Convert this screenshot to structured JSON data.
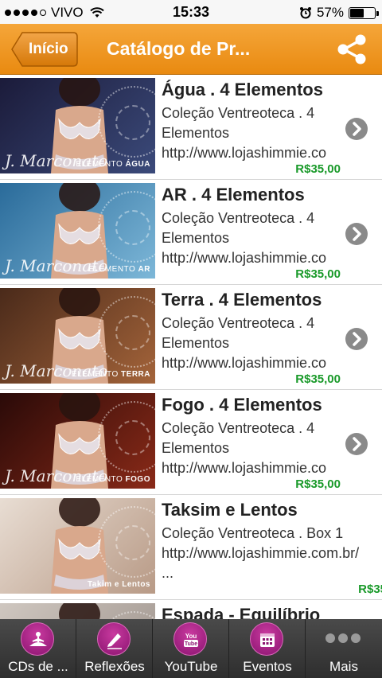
{
  "status_bar": {
    "carrier": "VIVO",
    "time": "15:33",
    "battery": "57%",
    "battery_level": 0.57
  },
  "nav": {
    "back_label": "Início",
    "title": "Catálogo de Pr..."
  },
  "items": [
    {
      "title": "Água . 4 Elementos",
      "desc": [
        "Coleção Ventreoteca . 4",
        "Elementos",
        "http://www.lojashimmie.co"
      ],
      "price": "R$35,00",
      "thumb_brand": "J. Marconato",
      "thumb_tag_prefix": "ELEMENTO",
      "thumb_tag": "ÁGUA",
      "thumb_colors": [
        "#1b1b3a",
        "#3b4a7a"
      ]
    },
    {
      "title": "AR . 4 Elementos",
      "desc": [
        "Coleção Ventreoteca . 4",
        "Elementos",
        "http://www.lojashimmie.co"
      ],
      "price": "R$35,00",
      "thumb_brand": "J. Marconato",
      "thumb_tag_prefix": "ELEMENTO",
      "thumb_tag": "AR",
      "thumb_colors": [
        "#2a6b9a",
        "#7db7d8"
      ]
    },
    {
      "title": "Terra . 4 Elementos",
      "desc": [
        "Coleção Ventreoteca . 4",
        "Elementos",
        "http://www.lojashimmie.co"
      ],
      "price": "R$35,00",
      "thumb_brand": "J. Marconato",
      "thumb_tag_prefix": "ELEMENTO",
      "thumb_tag": "TERRA",
      "thumb_colors": [
        "#4a2a1a",
        "#a4643a"
      ]
    },
    {
      "title": "Fogo . 4 Elementos",
      "desc": [
        "Coleção Ventreoteca . 4",
        "Elementos",
        "http://www.lojashimmie.co"
      ],
      "price": "R$35,00",
      "thumb_brand": "J. Marconato",
      "thumb_tag_prefix": "ELEMENTO",
      "thumb_tag": "FOGO",
      "thumb_colors": [
        "#2a0a08",
        "#8a2a18"
      ]
    },
    {
      "title": "Taksim e Lentos",
      "desc": [
        "Coleção Ventreoteca . Box 1",
        "http://www.lojashimmie.com.br/",
        "..."
      ],
      "price": "R$35",
      "thumb_brand": "",
      "thumb_tag_prefix": "",
      "thumb_tag": "Takim e Lentos",
      "thumb_colors": [
        "#e8ddd3",
        "#b89a86"
      ]
    },
    {
      "title": "Espada - Equilíbrio",
      "desc": [],
      "price": "",
      "thumb_brand": "",
      "thumb_tag_prefix": "",
      "thumb_tag": "",
      "thumb_colors": [
        "#cfc7c0",
        "#9a8f88"
      ]
    }
  ],
  "tabs": [
    {
      "label": "CDs de ...",
      "icon": "meditation-icon"
    },
    {
      "label": "Reflexões",
      "icon": "pencil-icon"
    },
    {
      "label": "YouTube",
      "icon": "youtube-icon"
    },
    {
      "label": "Eventos",
      "icon": "calendar-icon"
    },
    {
      "label": "Mais",
      "icon": "more-icon"
    }
  ],
  "colors": {
    "nav_orange": "#f09a26",
    "price_green": "#1a9a2a",
    "tab_accent": "#b0288a"
  }
}
